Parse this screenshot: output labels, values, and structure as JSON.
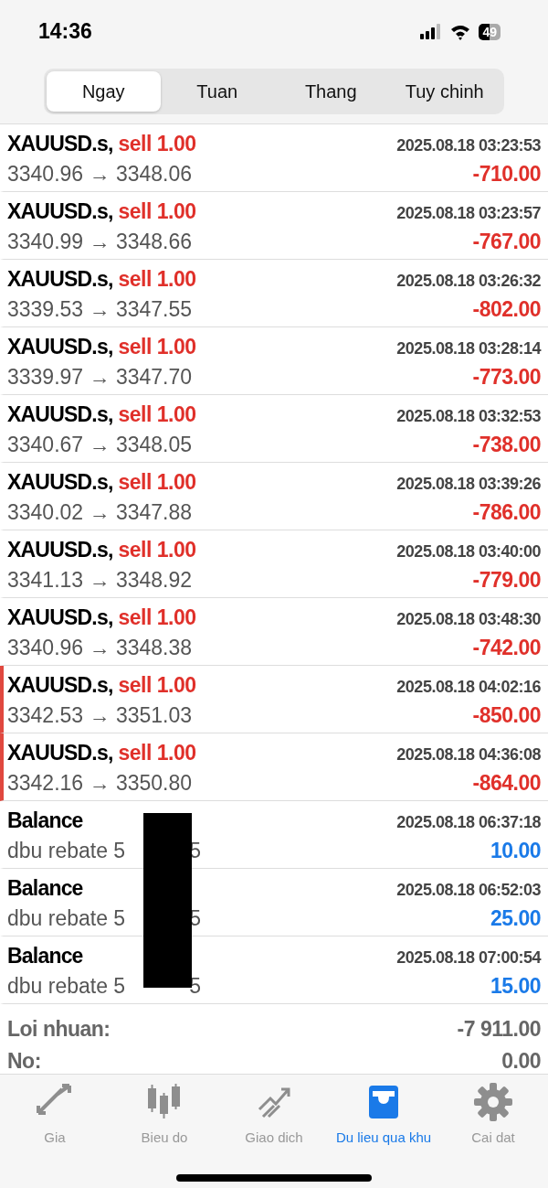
{
  "status_bar": {
    "time": "14:36",
    "battery": "49"
  },
  "tabs": [
    {
      "label": "Ngay",
      "selected": true
    },
    {
      "label": "Tuan",
      "selected": false
    },
    {
      "label": "Thang",
      "selected": false
    },
    {
      "label": "Tuy chinh",
      "selected": false
    }
  ],
  "deals": [
    {
      "kind": "trade",
      "symbol": "XAUUSD.s,",
      "side": "sell 1.00",
      "prices": "3340.96 → 3348.06",
      "time": "2025.08.18 03:23:53",
      "profit": "-710.00",
      "marked": false
    },
    {
      "kind": "trade",
      "symbol": "XAUUSD.s,",
      "side": "sell 1.00",
      "prices": "3340.99 → 3348.66",
      "time": "2025.08.18 03:23:57",
      "profit": "-767.00",
      "marked": false
    },
    {
      "kind": "trade",
      "symbol": "XAUUSD.s,",
      "side": "sell 1.00",
      "prices": "3339.53 → 3347.55",
      "time": "2025.08.18 03:26:32",
      "profit": "-802.00",
      "marked": false
    },
    {
      "kind": "trade",
      "symbol": "XAUUSD.s,",
      "side": "sell 1.00",
      "prices": "3339.97 → 3347.70",
      "time": "2025.08.18 03:28:14",
      "profit": "-773.00",
      "marked": false
    },
    {
      "kind": "trade",
      "symbol": "XAUUSD.s,",
      "side": "sell 1.00",
      "prices": "3340.67 → 3348.05",
      "time": "2025.08.18 03:32:53",
      "profit": "-738.00",
      "marked": false
    },
    {
      "kind": "trade",
      "symbol": "XAUUSD.s,",
      "side": "sell 1.00",
      "prices": "3340.02 → 3347.88",
      "time": "2025.08.18 03:39:26",
      "profit": "-786.00",
      "marked": false
    },
    {
      "kind": "trade",
      "symbol": "XAUUSD.s,",
      "side": "sell 1.00",
      "prices": "3341.13 → 3348.92",
      "time": "2025.08.18 03:40:00",
      "profit": "-779.00",
      "marked": false
    },
    {
      "kind": "trade",
      "symbol": "XAUUSD.s,",
      "side": "sell 1.00",
      "prices": "3340.96 → 3348.38",
      "time": "2025.08.18 03:48:30",
      "profit": "-742.00",
      "marked": false
    },
    {
      "kind": "trade",
      "symbol": "XAUUSD.s,",
      "side": "sell 1.00",
      "prices": "3342.53 → 3351.03",
      "time": "2025.08.18 04:02:16",
      "profit": "-850.00",
      "marked": true
    },
    {
      "kind": "trade",
      "symbol": "XAUUSD.s,",
      "side": "sell 1.00",
      "prices": "3342.16 → 3350.80",
      "time": "2025.08.18 04:36:08",
      "profit": "-864.00",
      "marked": true
    },
    {
      "kind": "balance",
      "symbol": "Balance",
      "comment": "dbu rebate 5",
      "comment_end": "5",
      "time": "2025.08.18 06:37:18",
      "profit": "10.00"
    },
    {
      "kind": "balance",
      "symbol": "Balance",
      "comment": "dbu rebate 5",
      "comment_end": "5",
      "time": "2025.08.18 06:52:03",
      "profit": "25.00"
    },
    {
      "kind": "balance",
      "symbol": "Balance",
      "comment": "dbu rebate 5",
      "comment_end": "5",
      "time": "2025.08.18 07:00:54",
      "profit": "15.00"
    }
  ],
  "summary": [
    {
      "label": "Loi nhuan:",
      "value": "-7 911.00"
    },
    {
      "label": "No:",
      "value": "0.00"
    }
  ],
  "nav": [
    {
      "kind": "quotes",
      "label": "Gia",
      "selected": false
    },
    {
      "kind": "chart",
      "label": "Bieu do",
      "selected": false
    },
    {
      "kind": "trade",
      "label": "Giao dich",
      "selected": false
    },
    {
      "kind": "history",
      "label": "Du lieu qua khu",
      "selected": true
    },
    {
      "kind": "settings",
      "label": "Cai dat",
      "selected": false
    }
  ]
}
